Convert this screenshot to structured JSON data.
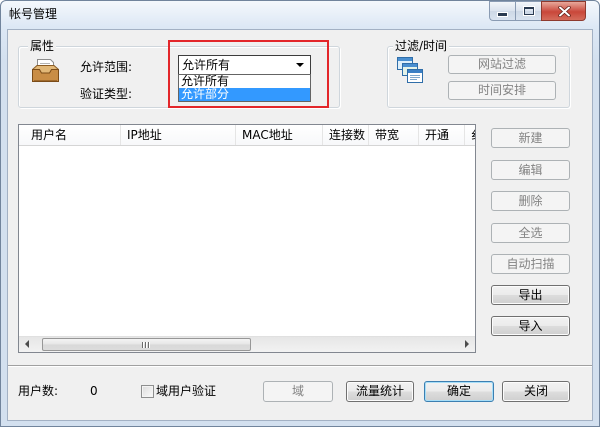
{
  "window": {
    "title": "帐号管理",
    "controls": {
      "minimize_icon": "minimize-icon",
      "maximize_icon": "maximize-icon",
      "close_icon": "close-icon"
    }
  },
  "properties": {
    "group_label": "属性",
    "icon": "inbox-tray-icon",
    "scope_label": "允许范围:",
    "auth_label": "验证类型:",
    "scope_select": {
      "value": "允许所有",
      "expanded": true,
      "options": [
        {
          "label": "允许所有",
          "highlighted": false
        },
        {
          "label": "允许部分",
          "highlighted": true
        }
      ]
    }
  },
  "filter_time": {
    "group_label": "过滤/时间",
    "icon": "stacked-windows-icon",
    "site_filter": {
      "label": "网站过滤",
      "enabled": false
    },
    "schedule": {
      "label": "时间安排",
      "enabled": false
    }
  },
  "user_list": {
    "columns": [
      "用户名",
      "IP地址",
      "MAC地址",
      "连接数",
      "带宽",
      "开通",
      "纟"
    ],
    "rows": []
  },
  "actions": [
    {
      "label": "新建",
      "enabled": false
    },
    {
      "label": "编辑",
      "enabled": false
    },
    {
      "label": "删除",
      "enabled": false
    },
    {
      "label": "全选",
      "enabled": false
    },
    {
      "label": "自动扫描",
      "enabled": false
    },
    {
      "label": "导出",
      "enabled": true
    },
    {
      "label": "导入",
      "enabled": true
    }
  ],
  "footer": {
    "user_count_label": "用户数:",
    "user_count": "0",
    "domain_auth": {
      "label": "域用户验证",
      "checked": false
    },
    "domain_button": {
      "label": "域",
      "enabled": false
    },
    "traffic_button": {
      "label": "流量统计",
      "enabled": true
    },
    "ok_button": {
      "label": "确定",
      "enabled": true,
      "default": true
    },
    "close_button": {
      "label": "关闭",
      "enabled": true
    }
  },
  "colors": {
    "selection": "#3399ff",
    "annotation": "#e3262a",
    "close_button": "#c9473a",
    "default_button_border": "#3c7fb1"
  }
}
